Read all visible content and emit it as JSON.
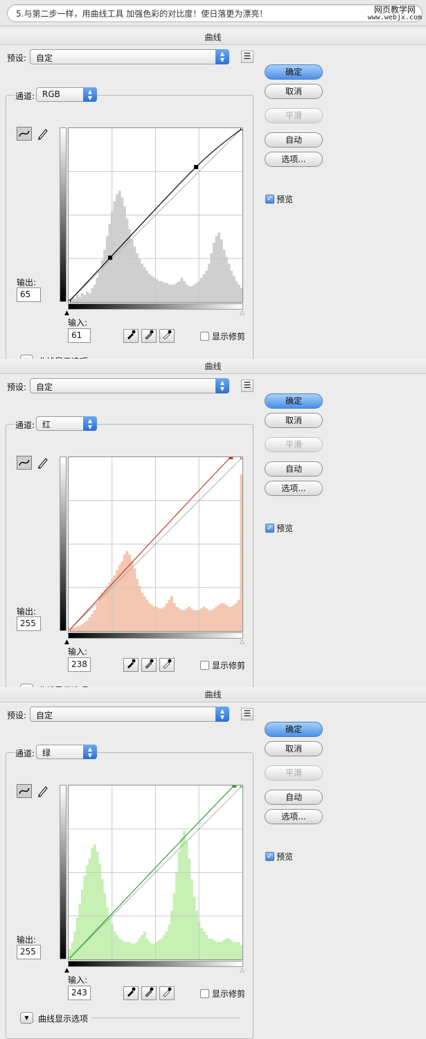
{
  "header": {
    "note": "5.与第二步一样，用曲线工具 加强色彩的对比度！使日落更为漂亮！",
    "wm_line1": "网页教学网",
    "wm_line2": "www.webjx.com"
  },
  "dialogs": [
    {
      "title": "曲线",
      "preset_label": "预设:",
      "preset_value": "自定",
      "buttons": {
        "ok": "确定",
        "cancel": "取消",
        "smooth": "平滑",
        "auto": "自动",
        "options": "选项..."
      },
      "preview_label": "预览",
      "channel_label": "通道:",
      "channel_value": "RGB",
      "output_label": "输出:",
      "output_value": "65",
      "input_label": "输入:",
      "input_value": "61",
      "clipping_label": "显示修剪",
      "curve_options_label": "曲线显示选项",
      "curve_color": "#000000",
      "hist_color": "#cfcfcf",
      "curve_points": [
        [
          0,
          0
        ],
        [
          61,
          65
        ],
        [
          187,
          198
        ],
        [
          255,
          255
        ]
      ],
      "histogram": [
        2,
        3,
        2,
        4,
        3,
        5,
        4,
        6,
        5,
        8,
        10,
        14,
        18,
        24,
        30,
        38,
        45,
        52,
        58,
        62,
        64,
        60,
        55,
        48,
        42,
        36,
        32,
        28,
        25,
        22,
        20,
        18,
        16,
        15,
        14,
        13,
        12,
        12,
        11,
        11,
        10,
        10,
        10,
        11,
        12,
        14,
        12,
        10,
        9,
        9,
        10,
        11,
        12,
        14,
        16,
        18,
        22,
        28,
        34,
        38,
        40,
        36,
        30,
        26,
        22,
        18,
        15,
        12,
        10,
        8
      ]
    },
    {
      "title": "曲线",
      "preset_label": "预设:",
      "preset_value": "自定",
      "buttons": {
        "ok": "确定",
        "cancel": "取消",
        "smooth": "平滑",
        "auto": "自动",
        "options": "选项..."
      },
      "preview_label": "预览",
      "channel_label": "通道:",
      "channel_value": "红",
      "output_label": "输出:",
      "output_value": "255",
      "input_label": "输入:",
      "input_value": "238",
      "clipping_label": "显示修剪",
      "curve_options_label": "曲线显示选项",
      "curve_color": "#c0392b",
      "hist_color": "#f3c7b2",
      "curve_points": [
        [
          0,
          0
        ],
        [
          238,
          255
        ],
        [
          255,
          255
        ]
      ],
      "histogram": [
        1,
        2,
        2,
        3,
        3,
        4,
        5,
        6,
        8,
        10,
        12,
        16,
        20,
        22,
        24,
        26,
        28,
        30,
        32,
        35,
        38,
        40,
        44,
        46,
        44,
        40,
        36,
        30,
        26,
        22,
        20,
        18,
        16,
        15,
        14,
        14,
        13,
        13,
        14,
        16,
        18,
        20,
        16,
        14,
        13,
        12,
        12,
        13,
        14,
        13,
        12,
        12,
        12,
        13,
        14,
        13,
        12,
        12,
        13,
        14,
        15,
        16,
        16,
        15,
        14,
        14,
        15,
        16,
        18,
        90
      ]
    },
    {
      "title": "曲线",
      "preset_label": "预设:",
      "preset_value": "自定",
      "buttons": {
        "ok": "确定",
        "cancel": "取消",
        "smooth": "平滑",
        "auto": "自动",
        "options": "选项..."
      },
      "preview_label": "预览",
      "channel_label": "通道:",
      "channel_value": "绿",
      "output_label": "输出:",
      "output_value": "255",
      "input_label": "输入:",
      "input_value": "243",
      "clipping_label": "显示修剪",
      "curve_options_label": "曲线显示选项",
      "curve_color": "#2e9e2e",
      "hist_color": "#c6f0b4",
      "curve_points": [
        [
          0,
          0
        ],
        [
          243,
          255
        ],
        [
          255,
          255
        ]
      ],
      "histogram": [
        6,
        10,
        16,
        24,
        32,
        40,
        48,
        54,
        58,
        64,
        66,
        62,
        55,
        46,
        38,
        30,
        24,
        20,
        16,
        14,
        12,
        11,
        10,
        10,
        10,
        9,
        9,
        10,
        12,
        14,
        16,
        12,
        10,
        9,
        9,
        10,
        11,
        12,
        14,
        16,
        20,
        28,
        38,
        50,
        62,
        70,
        74,
        68,
        58,
        46,
        36,
        28,
        22,
        18,
        16,
        14,
        12,
        12,
        11,
        10,
        10,
        10,
        11,
        12,
        12,
        11,
        10,
        10,
        10,
        8
      ]
    }
  ]
}
